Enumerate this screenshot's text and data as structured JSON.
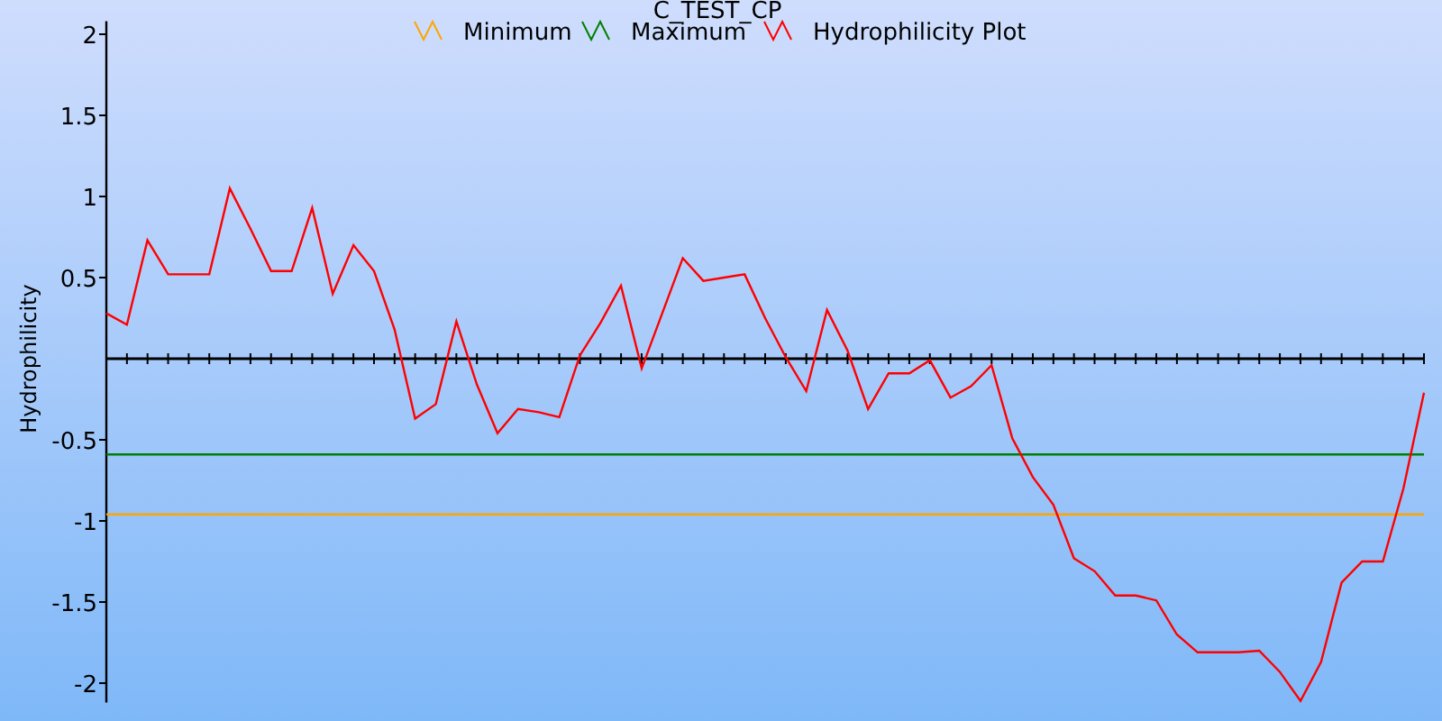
{
  "chart_data": {
    "type": "line",
    "title": "C_TEST_CP",
    "ylabel": "Hydrophilicity",
    "yticks": [
      2,
      1.5,
      1,
      0.5,
      -0.5,
      -1,
      -1.5,
      -2
    ],
    "ylim": [
      -2.12,
      2.08
    ],
    "legend": "top",
    "series": [
      {
        "name": "Minimum",
        "color": "#ffa500",
        "values": [
          -0.96,
          -0.96,
          -0.96,
          -0.96,
          -0.96,
          -0.96,
          -0.96,
          -0.96,
          -0.96,
          -0.96,
          -0.96,
          -0.96,
          -0.96,
          -0.96,
          -0.96,
          -0.96,
          -0.96,
          -0.96,
          -0.96,
          -0.96,
          -0.96,
          -0.96,
          -0.96,
          -0.96,
          -0.96,
          -0.96,
          -0.96,
          -0.96,
          -0.96,
          -0.96,
          -0.96,
          -0.96,
          -0.96,
          -0.96,
          -0.96,
          -0.96,
          -0.96,
          -0.96,
          -0.96,
          -0.96,
          -0.96,
          -0.96,
          -0.96,
          -0.96,
          -0.96,
          -0.96,
          -0.96,
          -0.96,
          -0.96,
          -0.96,
          -0.96,
          -0.96,
          -0.96,
          -0.96,
          -0.96,
          -0.96,
          -0.96,
          -0.96,
          -0.96,
          -0.96,
          -0.96,
          -0.96,
          -0.96,
          -0.96,
          -0.96
        ]
      },
      {
        "name": "Maximum",
        "color": "#008000",
        "values": [
          -0.59,
          -0.59,
          -0.59,
          -0.59,
          -0.59,
          -0.59,
          -0.59,
          -0.59,
          -0.59,
          -0.59,
          -0.59,
          -0.59,
          -0.59,
          -0.59,
          -0.59,
          -0.59,
          -0.59,
          -0.59,
          -0.59,
          -0.59,
          -0.59,
          -0.59,
          -0.59,
          -0.59,
          -0.59,
          -0.59,
          -0.59,
          -0.59,
          -0.59,
          -0.59,
          -0.59,
          -0.59,
          -0.59,
          -0.59,
          -0.59,
          -0.59,
          -0.59,
          -0.59,
          -0.59,
          -0.59,
          -0.59,
          -0.59,
          -0.59,
          -0.59,
          -0.59,
          -0.59,
          -0.59,
          -0.59,
          -0.59,
          -0.59,
          -0.59,
          -0.59,
          -0.59,
          -0.59,
          -0.59,
          -0.59,
          -0.59,
          -0.59,
          -0.59,
          -0.59,
          -0.59,
          -0.59,
          -0.59,
          -0.59,
          -0.59
        ]
      },
      {
        "name": "Hydrophilicity Plot",
        "color": "#ff0000",
        "values": [
          0.28,
          0.21,
          0.73,
          0.52,
          0.52,
          0.52,
          1.05,
          0.8,
          0.54,
          0.54,
          0.93,
          0.4,
          0.7,
          0.54,
          0.18,
          -0.37,
          -0.28,
          0.23,
          -0.16,
          -0.46,
          -0.31,
          -0.33,
          -0.36,
          0.02,
          0.22,
          0.45,
          -0.06,
          0.28,
          0.62,
          0.48,
          0.5,
          0.52,
          0.25,
          0.01,
          -0.2,
          0.3,
          0.05,
          -0.31,
          -0.09,
          -0.09,
          -0.01,
          -0.24,
          -0.17,
          -0.04,
          -0.49,
          -0.73,
          -0.9,
          -1.23,
          -1.31,
          -1.46,
          -1.46,
          -1.49,
          -1.7,
          -1.81,
          -1.81,
          -1.81,
          -1.8,
          -1.93,
          -2.11,
          -1.87,
          -1.38,
          -1.25,
          -1.25,
          -0.8,
          -0.21
        ]
      }
    ]
  }
}
